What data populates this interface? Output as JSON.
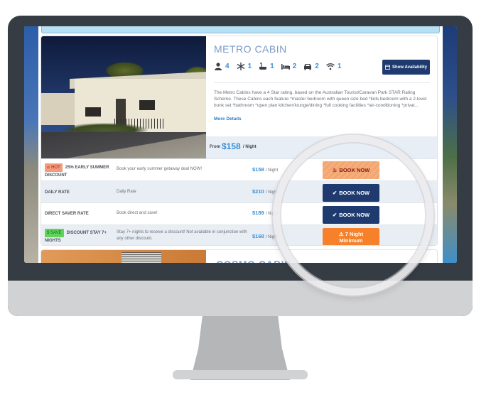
{
  "listing": {
    "title": "METRO CABIN",
    "amenities": [
      {
        "icon": "guests-icon",
        "count": "4"
      },
      {
        "icon": "air-conditioning-icon",
        "count": "1"
      },
      {
        "icon": "bathroom-icon",
        "count": "1"
      },
      {
        "icon": "bed-icon",
        "count": "2"
      },
      {
        "icon": "car-icon",
        "count": "2"
      },
      {
        "icon": "wifi-icon",
        "count": "1"
      }
    ],
    "show_availability_label": "Show Availability",
    "description": "The Metro Cabins have a 4 Star rating, based on the Australian Tourist/Caravan Park STAR Rating Scheme. These Cabins each feature *master bedroom with queen size bed *kids bedroom with a 2-level bunk set *bathroom *open plan kitchen/lounge/dining *full cooking facilities *air-conditioning *privat...",
    "more_details_label": "More Details",
    "from_label": "From",
    "from_price": "$158",
    "per_night_label": "/ Night"
  },
  "rates": [
    {
      "badge": "HOT",
      "badge_type": "hot",
      "name": "25% EARLY SUMMER DISCOUNT",
      "description": "Book your early summer getaway deal NOW!",
      "price": "$158",
      "unit": "/ Night",
      "button": "BOOK NOW",
      "button_type": "hot"
    },
    {
      "badge": "",
      "badge_type": "",
      "name": "DAILY RATE",
      "description": "Daily Rate",
      "price": "$210",
      "unit": "/ Night",
      "button": "BOOK NOW",
      "button_type": "blue"
    },
    {
      "badge": "",
      "badge_type": "",
      "name": "DIRECT SAVER RATE",
      "description": "Book direct and save!",
      "price": "$189",
      "unit": "/ Night",
      "button": "BOOK NOW",
      "button_type": "blue"
    },
    {
      "badge": "$ SAVE",
      "badge_type": "save",
      "name": "DISCOUNT STAY 7+ NIGHTS",
      "description": "Stay 7+ nights to receive a discount! Not available in conjunction with any other discount.",
      "price": "$168",
      "unit": "/ Night",
      "button_line1": "7 Night",
      "button_line2": "Minimum",
      "button_type": "orange"
    }
  ],
  "next_listing": {
    "title": "COSMO CABIN"
  },
  "colors": {
    "accent_blue": "#3a8fd6",
    "navy_button": "#1e3a6e",
    "orange_button": "#f6812a",
    "hot_badge": "#f39c7d",
    "save_badge": "#5fd35a"
  }
}
